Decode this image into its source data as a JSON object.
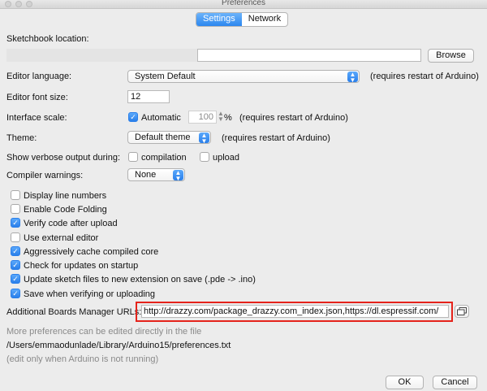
{
  "window": {
    "title": "Preferences"
  },
  "tabs": [
    {
      "label": "Settings",
      "active": true
    },
    {
      "label": "Network",
      "active": false
    }
  ],
  "sketchbook": {
    "label": "Sketchbook location:",
    "value": "",
    "browse_label": "Browse"
  },
  "editor_language": {
    "label": "Editor language:",
    "value": "System Default",
    "note": "(requires restart of Arduino)"
  },
  "editor_font_size": {
    "label": "Editor font size:",
    "value": "12"
  },
  "interface_scale": {
    "label": "Interface scale:",
    "automatic_label": "Automatic",
    "automatic_checked": true,
    "value": "100",
    "unit": "%",
    "note": "(requires restart of Arduino)"
  },
  "theme": {
    "label": "Theme:",
    "value": "Default theme",
    "note": "(requires restart of Arduino)"
  },
  "verbose": {
    "label": "Show verbose output during:",
    "compilation_label": "compilation",
    "compilation_checked": false,
    "upload_label": "upload",
    "upload_checked": false
  },
  "compiler_warnings": {
    "label": "Compiler warnings:",
    "value": "None"
  },
  "options": [
    {
      "label": "Display line numbers",
      "checked": false
    },
    {
      "label": "Enable Code Folding",
      "checked": false
    },
    {
      "label": "Verify code after upload",
      "checked": true
    },
    {
      "label": "Use external editor",
      "checked": false
    },
    {
      "label": "Aggressively cache compiled core",
      "checked": true
    },
    {
      "label": "Check for updates on startup",
      "checked": true
    },
    {
      "label": "Update sketch files to new extension on save (.pde -> .ino)",
      "checked": true
    },
    {
      "label": "Save when verifying or uploading",
      "checked": true
    }
  ],
  "boards_manager": {
    "label": "Additional Boards Manager URLs:",
    "value": "http://drazzy.com/package_drazzy.com_index.json,https://dl.espressif.com/"
  },
  "footer": {
    "more_prefs": "More preferences can be edited directly in the file",
    "prefs_path": "/Users/emmaodunlade/Library/Arduino15/preferences.txt",
    "edit_note": "(edit only when Arduino is not running)"
  },
  "buttons": {
    "ok_label": "OK",
    "cancel_label": "Cancel"
  },
  "colors": {
    "accent": "#2c87ef",
    "highlight": "#e5231b",
    "background": "#ececec"
  }
}
